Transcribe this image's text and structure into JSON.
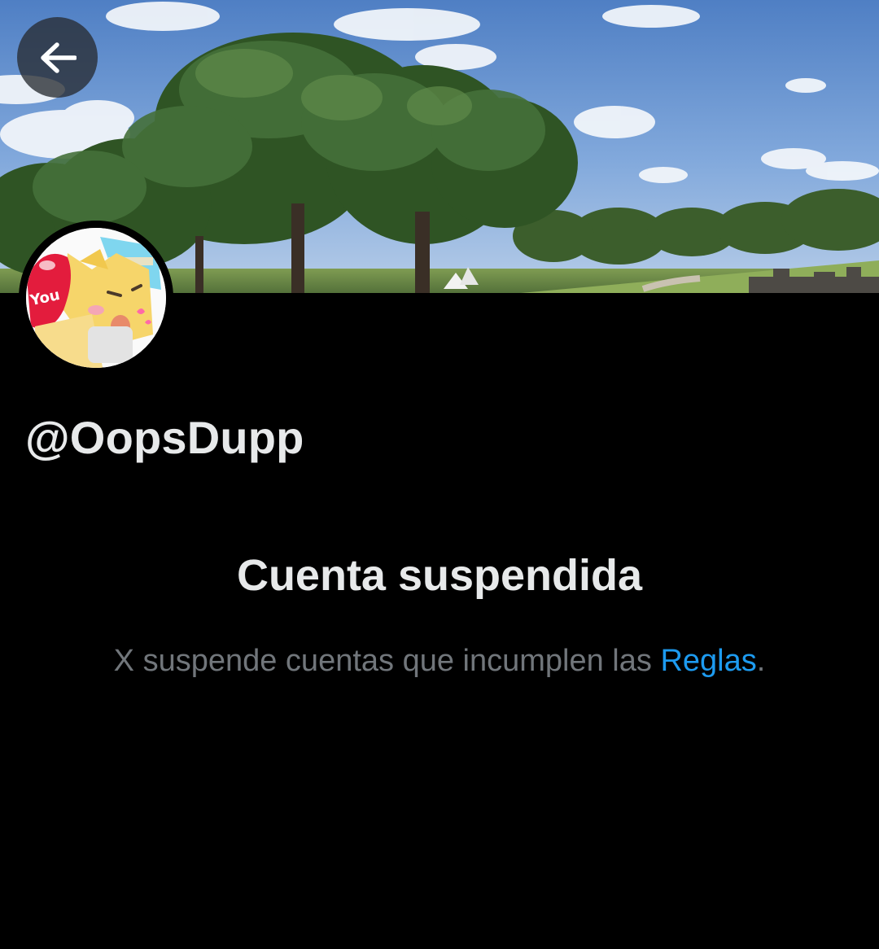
{
  "profile": {
    "handle": "@OopsDupp",
    "avatar_text": "You"
  },
  "header": {
    "back_icon": "arrow-left-icon"
  },
  "suspension": {
    "title": "Cuenta suspendida",
    "message_prefix": "X suspende cuentas que incumplen las ",
    "rules_link": "Reglas",
    "message_suffix": "."
  },
  "colors": {
    "background": "#000000",
    "primary_text": "#e7e9ea",
    "secondary_text": "#71767b",
    "link": "#1d9bf0"
  }
}
